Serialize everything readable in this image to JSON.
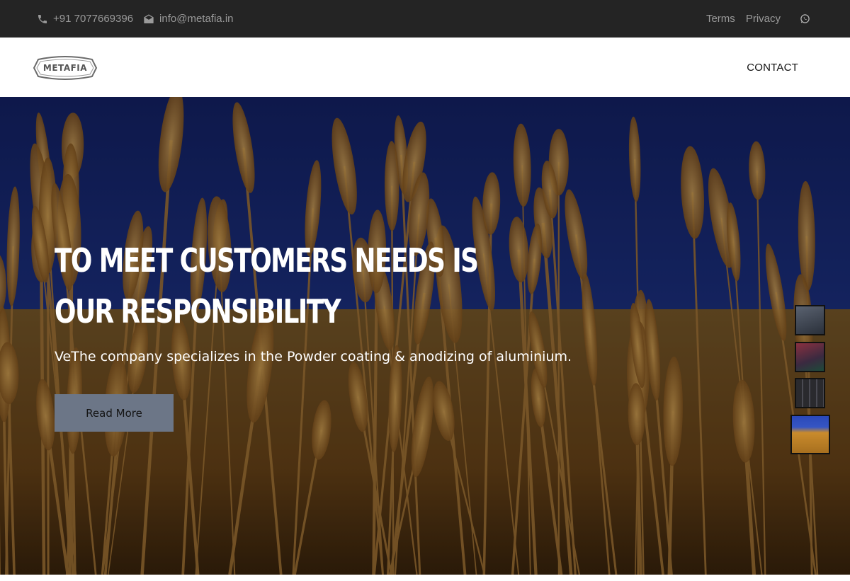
{
  "topbar": {
    "phone": "+91 7077669396",
    "email": "info@metafia.in",
    "links": [
      "Terms",
      "Privacy"
    ],
    "icons": {
      "phone": "phone-icon",
      "email": "envelope-icon",
      "social": "whatsapp-icon"
    }
  },
  "header": {
    "logo_text": "METAFIA",
    "nav": {
      "contact_label": "CONTACT"
    }
  },
  "hero": {
    "title": "TO MEET CUSTOMERS NEEDS IS OUR RESPONSIBILITY",
    "subtitle": "VeThe company specializes in the Powder coating & anodizing of aluminium.",
    "button_label": "Read More",
    "thumbnails": [
      {
        "name": "slide-1-thumbnail",
        "color": "#3a4250"
      },
      {
        "name": "slide-2-thumbnail",
        "color": "#6a2a3a"
      },
      {
        "name": "slide-3-thumbnail",
        "color": "#2e2e32"
      },
      {
        "name": "slide-4-thumbnail",
        "color": "#c98b2c",
        "active": true
      }
    ]
  },
  "colors": {
    "topbar_bg": "#242424",
    "topbar_text": "#9a9a9a",
    "button_bg": "#6c7687",
    "sky": "#1f3488",
    "wheat": "#b07a2a"
  }
}
